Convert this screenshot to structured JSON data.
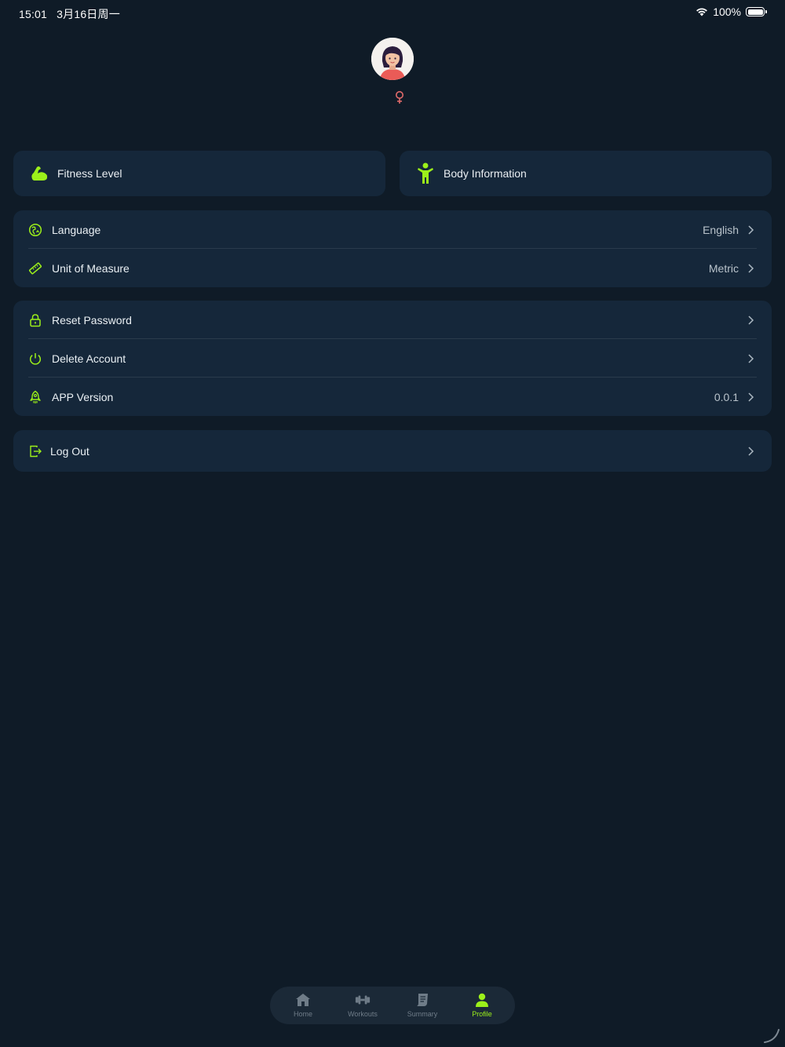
{
  "status_bar": {
    "time": "15:01",
    "date": "3月16日周一",
    "battery_percent": "100%",
    "battery_level": 1.0
  },
  "colors": {
    "background": "#0f1b27",
    "card": "#15273a",
    "accent": "#9cf01a",
    "gender_icon": "#e06a6a",
    "muted": "#6f7c88"
  },
  "profile": {
    "avatar_icon": "female-avatar",
    "gender_icon": "female-symbol-icon"
  },
  "tiles": [
    {
      "label": "Fitness Level",
      "icon": "flexed-arm-icon"
    },
    {
      "label": "Body Information",
      "icon": "person-icon"
    }
  ],
  "settings": {
    "language": {
      "label": "Language",
      "value": "English",
      "icon": "language-icon"
    },
    "unit": {
      "label": "Unit of Measure",
      "value": "Metric",
      "icon": "ruler-icon"
    },
    "reset_password": {
      "label": "Reset Password",
      "icon": "lock-icon"
    },
    "delete_account": {
      "label": "Delete Account",
      "icon": "power-icon"
    },
    "app_version": {
      "label": "APP Version",
      "value": "0.0.1",
      "icon": "rocket-icon"
    },
    "logout": {
      "label": "Log Out",
      "icon": "logout-icon"
    }
  },
  "tabbar": {
    "items": [
      {
        "label": "Home",
        "icon": "home-icon",
        "active": false
      },
      {
        "label": "Workouts",
        "icon": "dumbbell-icon",
        "active": false
      },
      {
        "label": "Summary",
        "icon": "document-icon",
        "active": false
      },
      {
        "label": "Profile",
        "icon": "person-icon",
        "active": true
      }
    ]
  }
}
